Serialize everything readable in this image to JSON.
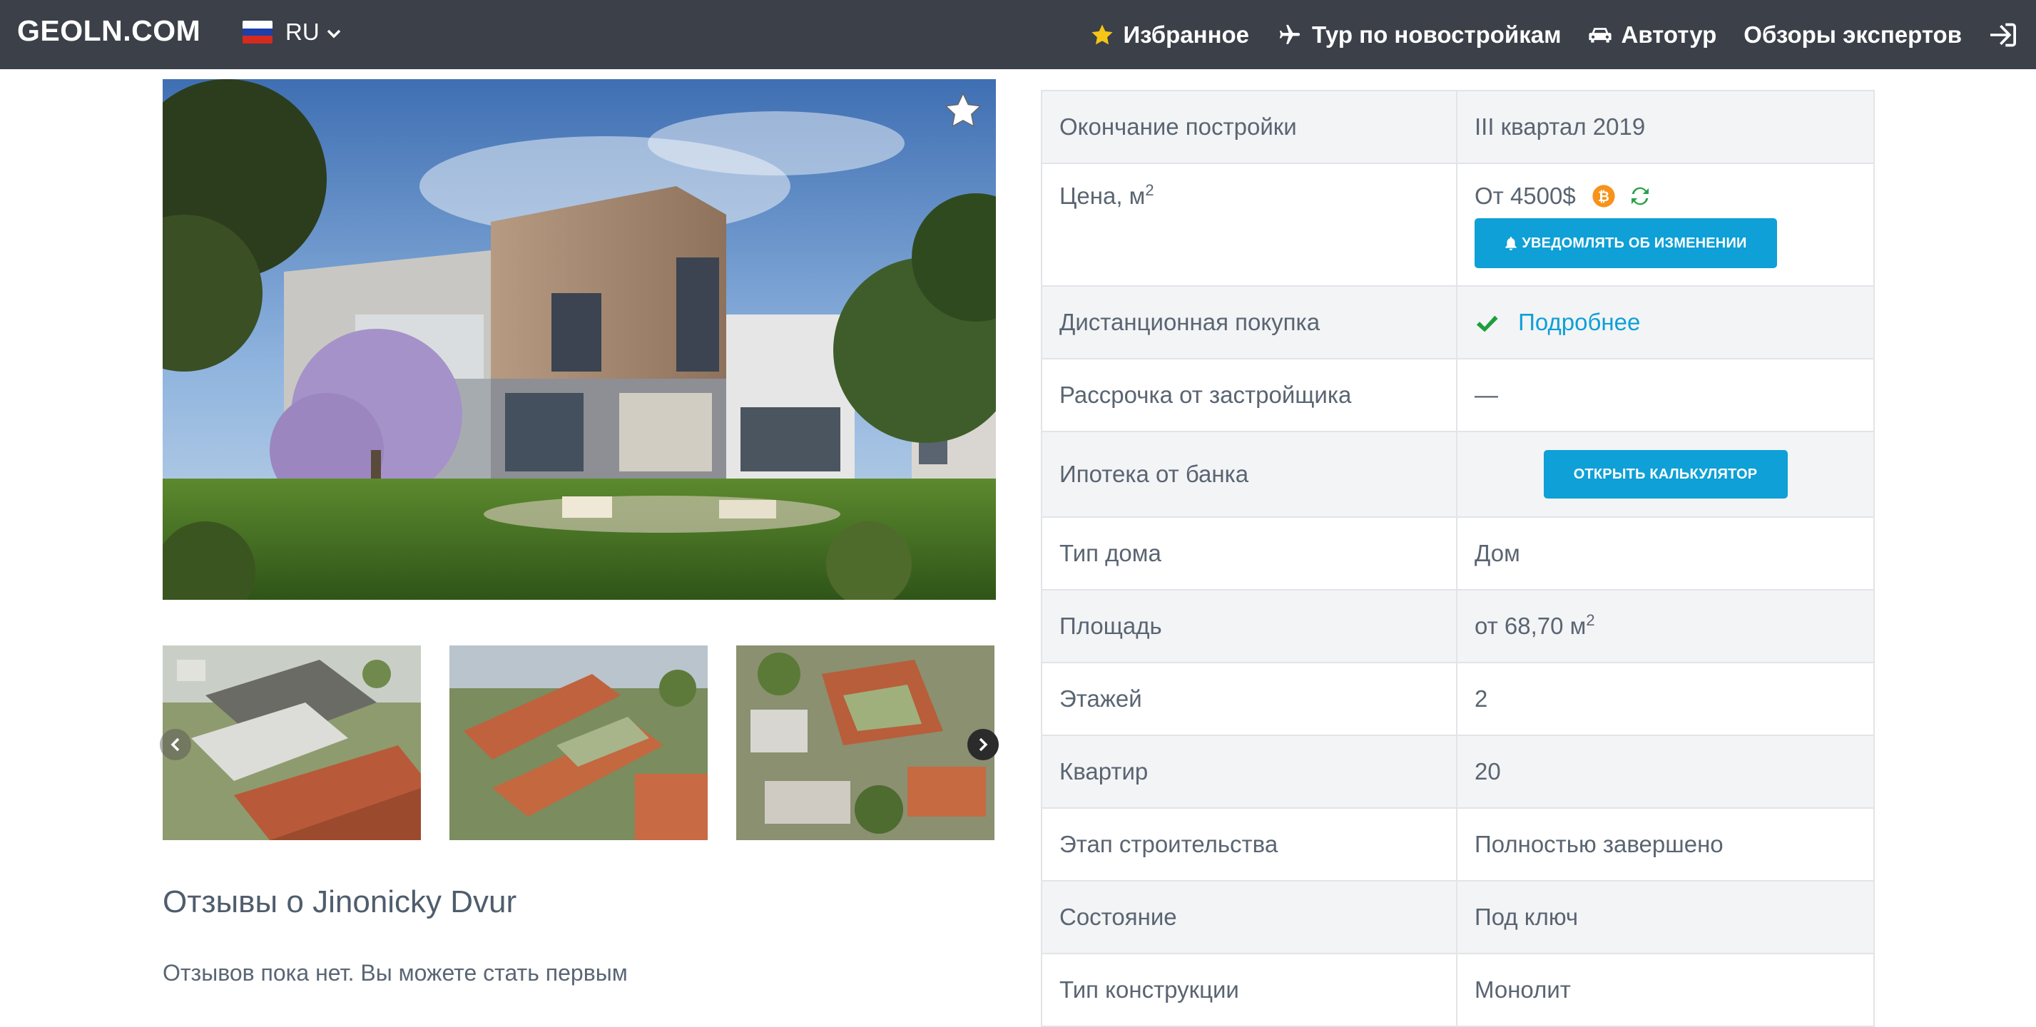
{
  "header": {
    "logo": "GEOLN.COM",
    "language": "RU",
    "nav": [
      {
        "label": "Избранное",
        "icon": "star-icon"
      },
      {
        "label": "Тур по новостройкам",
        "icon": "plane-icon"
      },
      {
        "label": "Автотур",
        "icon": "car-icon"
      },
      {
        "label": "Обзоры экспертов",
        "icon": ""
      }
    ]
  },
  "gallery": {
    "thumbs_count": 3
  },
  "reviews": {
    "title": "Отзывы о Jinonicky Dvur",
    "empty_text": "Отзывов пока нет. Вы можете стать первым"
  },
  "specs": {
    "completion": {
      "label": "Окончание постройки",
      "value": "III квартал 2019"
    },
    "price": {
      "label": "Цена, м",
      "sup": "2",
      "value": "От 4500$",
      "button": "УВЕДОМЛЯТЬ ОБ ИЗМЕНЕНИИ"
    },
    "remote": {
      "label": "Дистанционная покупка",
      "link": "Подробнее"
    },
    "installment": {
      "label": "Рассрочка от застройщика",
      "value": "—"
    },
    "mortgage": {
      "label": "Ипотека от банка",
      "button": "ОТКРЫТЬ КАЛЬКУЛЯТОР"
    },
    "house_type": {
      "label": "Тип дома",
      "value": "Дом"
    },
    "area": {
      "label": "Площадь",
      "value": "от 68,70 м",
      "sup": "2"
    },
    "floors": {
      "label": "Этажей",
      "value": "2"
    },
    "apartments": {
      "label": "Квартир",
      "value": "20"
    },
    "stage": {
      "label": "Этап строительства",
      "value": "Полностью завершено"
    },
    "condition": {
      "label": "Состояние",
      "value": "Под ключ"
    },
    "construction": {
      "label": "Тип конструкции",
      "value": "Монолит"
    }
  },
  "colors": {
    "topbar": "#3b4049",
    "accent": "#0ea0d6",
    "check": "#1e9e3a",
    "bitcoin": "#f7931a",
    "refresh": "#2aa34a"
  }
}
